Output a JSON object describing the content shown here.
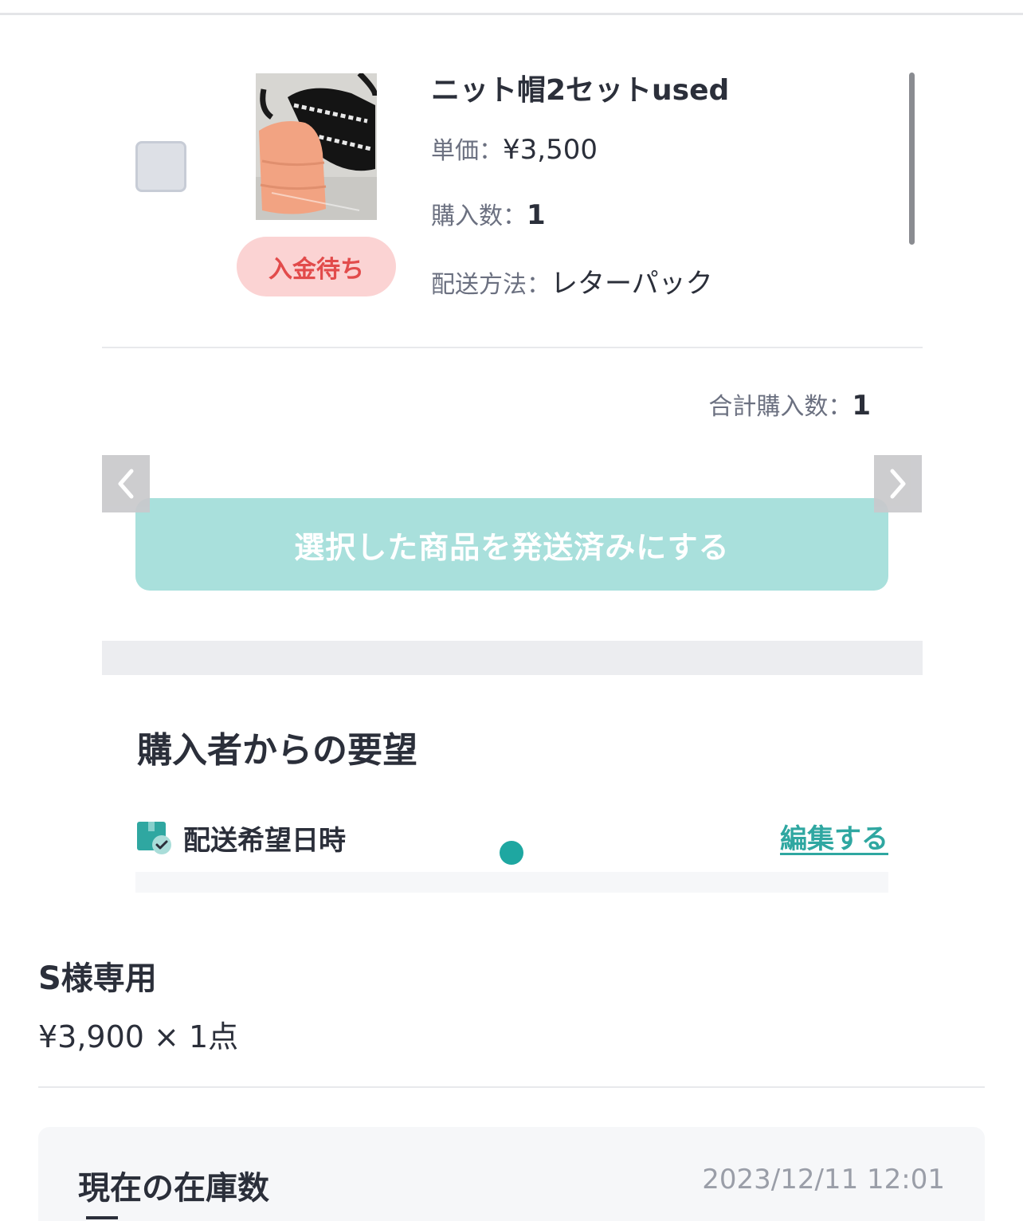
{
  "order_item": {
    "title": "ニット帽2セットused",
    "status": "入金待ち",
    "price_label": "単価：",
    "price_value": "¥3,500",
    "quantity_label": "購入数：",
    "quantity_value": "1",
    "shipping_label": "配送方法：",
    "shipping_value": "レターパック",
    "checked": false
  },
  "summary": {
    "total_label": "合計購入数：",
    "total_value": "1"
  },
  "actions": {
    "ship_button_label": "選択した商品を発送済みにする"
  },
  "buyer_requests": {
    "section_title": "購入者からの要望",
    "delivery_label": "配送希望日時",
    "edit_link": "編集する"
  },
  "listing": {
    "name": "S様専用",
    "price_quantity": "¥3,900 × 1点"
  },
  "stock": {
    "title": "現在の在庫数",
    "timestamp": "2023/12/11 12:01"
  },
  "colors": {
    "accent": "#2fa7a1",
    "button_disabled": "#a9e0dc",
    "status_bg": "#fbd3d3",
    "status_text": "#e24b4b"
  },
  "icons": {
    "delivery": "package-check-icon",
    "prev": "chevron-left-icon",
    "next": "chevron-right-icon"
  }
}
